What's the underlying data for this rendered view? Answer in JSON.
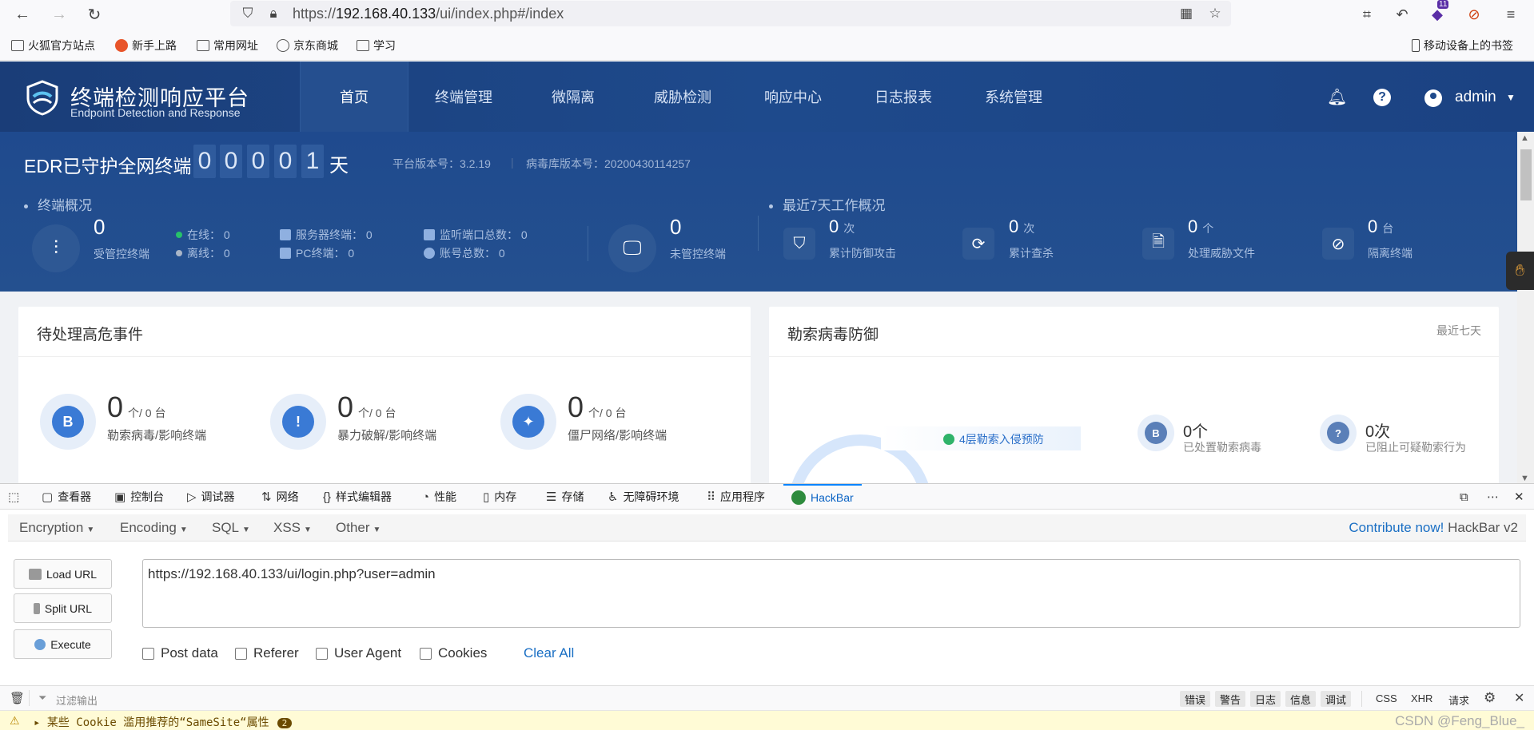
{
  "browser": {
    "url_prefix": "https://",
    "url_host": "192.168.40.133",
    "url_path": "/ui/index.php#/index",
    "bookmarks": [
      "火狐官方站点",
      "新手上路",
      "常用网址",
      "京东商城",
      "学习"
    ],
    "mobile_bookmarks": "移动设备上的书签",
    "extension_badge": "11"
  },
  "edr": {
    "brand_title": "终端检测响应平台",
    "brand_subtitle": "Endpoint Detection and Response",
    "menu": [
      "首页",
      "终端管理",
      "微隔离",
      "威胁检测",
      "响应中心",
      "日志报表",
      "系统管理"
    ],
    "username": "admin",
    "protect_title": "EDR已守护全网终端",
    "protect_days": [
      "0",
      "0",
      "0",
      "0",
      "1"
    ],
    "day_unit": "天",
    "platform_version": "平台版本号：3.2.19",
    "virus_db_version": "病毒库版本号：20200430114257",
    "overview_title": "终端概况",
    "managed": {
      "count": "0",
      "label": "受管控终端"
    },
    "online": "在线：  0",
    "offline": "离线：  0",
    "server_terminals": "服务器终端：  0",
    "pc_terminals": "PC终端：  0",
    "listening_ports": "监听端口总数：  0",
    "accounts": "账号总数：  0",
    "unmanaged": {
      "count": "0",
      "label": "未管控终端"
    },
    "week_title": "最近7天工作概况",
    "week_stats": [
      {
        "count": "0",
        "unit": "次",
        "label": "累计防御攻击"
      },
      {
        "count": "0",
        "unit": "次",
        "label": "累计查杀"
      },
      {
        "count": "0",
        "unit": "个",
        "label": "处理威胁文件"
      },
      {
        "count": "0",
        "unit": "台",
        "label": "隔离终端"
      }
    ],
    "pending_card": {
      "title": "待处理高危事件",
      "items": [
        {
          "count": "0",
          "unit": "个/ 0 台",
          "label": "勒索病毒/影响终端",
          "icon": "B"
        },
        {
          "count": "0",
          "unit": "个/ 0 台",
          "label": "暴力破解/影响终端",
          "icon": "!"
        },
        {
          "count": "0",
          "unit": "个/ 0 台",
          "label": "僵尸网络/影响终端",
          "icon": "✦"
        }
      ]
    },
    "ransom_card": {
      "title": "勒索病毒防御",
      "period": "最近七天",
      "layer_label": "4层勒索入侵预防",
      "handled": {
        "count": "0个",
        "label": "已处置勒索病毒"
      },
      "blocked": {
        "count": "0次",
        "label": "已阻止可疑勒索行为"
      }
    }
  },
  "devtools": {
    "tabs": [
      "查看器",
      "控制台",
      "调试器",
      "网络",
      "样式编辑器",
      "性能",
      "内存",
      "存储",
      "无障碍环境",
      "应用程序",
      "HackBar"
    ],
    "hackbar": {
      "menus": [
        "Encryption",
        "Encoding",
        "SQL",
        "XSS",
        "Other"
      ],
      "contribute_link": "Contribute now!",
      "version": "HackBar v2",
      "load_url": "Load URL",
      "split_url": "Split URL",
      "execute": "Execute",
      "url_value": "https://192.168.40.133/ui/login.php?user=admin",
      "checks": [
        "Post data",
        "Referer",
        "User Agent",
        "Cookies"
      ],
      "clear_all": "Clear All"
    },
    "console": {
      "filter_placeholder": "过滤输出",
      "levels": [
        "错误",
        "警告",
        "日志",
        "信息",
        "调试"
      ],
      "types": [
        "CSS",
        "XHR",
        "请求"
      ],
      "warning_text": "某些 Cookie 滥用推荐的“SameSite“属性",
      "warning_count": "2",
      "watermark": "CSDN @Feng_Blue_"
    }
  }
}
